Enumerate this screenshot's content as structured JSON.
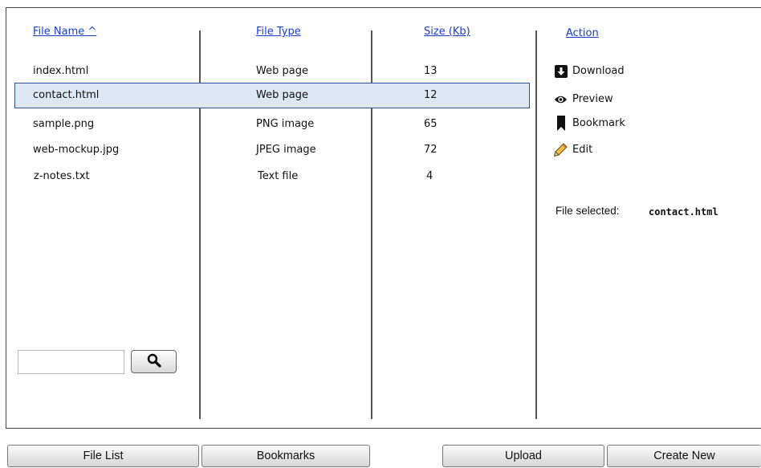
{
  "columns": {
    "file_name": "File Name ^",
    "file_type": "File Type",
    "size": "Size (Kb)",
    "action": "Action"
  },
  "files": [
    {
      "name": "index.html",
      "type": "Web page",
      "size": "13"
    },
    {
      "name": "contact.html",
      "type": "Web page",
      "size": "12"
    },
    {
      "name": "sample.png",
      "type": "PNG image",
      "size": "65"
    },
    {
      "name": "web-mockup.jpg",
      "type": "JPEG image",
      "size": "72"
    },
    {
      "name": "z-notes.txt",
      "type": "Text file",
      "size": "4"
    }
  ],
  "selected_index": 1,
  "actions": [
    {
      "label": "Download",
      "icon": "download-icon"
    },
    {
      "label": "Preview",
      "icon": "eye-icon"
    },
    {
      "label": "Bookmark",
      "icon": "bookmark-icon"
    },
    {
      "label": "Edit",
      "icon": "pencil-icon"
    }
  ],
  "selection": {
    "label": "File selected:",
    "value": "contact.html"
  },
  "search": {
    "value": "",
    "placeholder": "",
    "icon": "search-icon"
  },
  "buttons": {
    "file_list": "File List",
    "bookmarks": "Bookmarks",
    "upload": "Upload",
    "create_new": "Create New"
  }
}
